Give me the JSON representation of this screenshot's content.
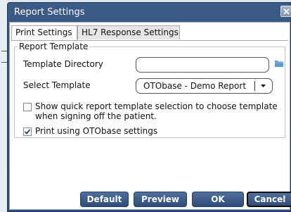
{
  "window": {
    "title": "Report Settings"
  },
  "tabs": [
    {
      "label": "Print Settings",
      "active": true
    },
    {
      "label": "HL7 Response Settings",
      "active": false
    }
  ],
  "report_template": {
    "legend": "Report Template",
    "template_directory_label": "Template Directory",
    "template_directory_value": "",
    "select_template_label": "Select Template",
    "select_template_value": "OTObase - Demo Report"
  },
  "options": {
    "quick_selection_label": "Show quick report template selection to choose template when signing off the patient.",
    "quick_selection_checked": false,
    "print_otobase_label": "Print using OTObase settings",
    "print_otobase_checked": true
  },
  "buttons": {
    "default": "Default",
    "preview": "Preview",
    "ok": "OK",
    "cancel": "Cancel"
  },
  "icons": {
    "close": "close-icon",
    "folder": "folder-icon",
    "dropdown": "chevron-down-icon",
    "checkmark": "checkmark-icon"
  },
  "colors": {
    "title_bar": "#2f4d79",
    "button": "#3d5d8a",
    "folder": "#5b9bd5"
  }
}
